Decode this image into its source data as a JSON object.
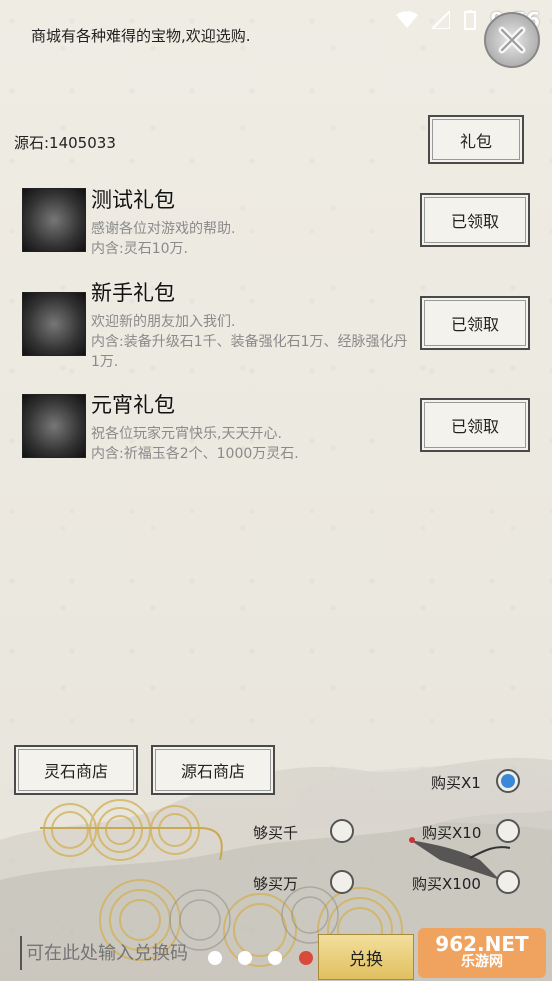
{
  "status": {
    "time": "9:56"
  },
  "header": {
    "welcome": "商城有各种难得的宝物,欢迎选购."
  },
  "currency": {
    "label": "源石:1405033"
  },
  "buttons": {
    "gift_pack": "礼包",
    "spirit_store": "灵石商店",
    "source_store": "源石商店",
    "exchange": "兑换"
  },
  "gifts": [
    {
      "title": "测试礼包",
      "line1": "感谢各位对游戏的帮助.",
      "line2": "内含:灵石10万.",
      "status": "已领取"
    },
    {
      "title": "新手礼包",
      "line1": "欢迎新的朋友加入我们.",
      "line2": "内含:装备升级石1千、装备强化石1万、经脉强化丹1万.",
      "status": "已领取"
    },
    {
      "title": "元宵礼包",
      "line1": "祝各位玩家元宵快乐,天天开心.",
      "line2": "内含:祈福玉各2个、1000万灵石.",
      "status": "已领取"
    }
  ],
  "purchase": {
    "buy_x1": "购买X1",
    "buy_x10": "购买X10",
    "buy_x100": "购买X100",
    "enough_thousand": "够买千",
    "enough_wan": "够买万",
    "selected": "购买X1"
  },
  "redeem": {
    "placeholder": "可在此处输入兑换码"
  },
  "pager": {
    "count": 5,
    "active": 4
  },
  "watermark": {
    "line1": "962.NET",
    "line2": "乐游网"
  },
  "colors": {
    "accent": "#3a89d9",
    "active_dot": "#d84a3a",
    "exchange_button": "#e8cc70"
  }
}
